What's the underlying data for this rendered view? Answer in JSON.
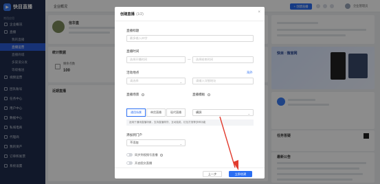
{
  "sidebar": {
    "brand": "快目直播",
    "section": "常用应用",
    "items": [
      {
        "label": "企业概况"
      },
      {
        "label": "直播"
      },
      {
        "label": "我的直播",
        "sub": true
      },
      {
        "label": "直播运营",
        "sub": true
      },
      {
        "label": "直播商城",
        "sub": true
      },
      {
        "label": "多渠道分发",
        "sub": true
      },
      {
        "label": "等级推送",
        "sub": true
      },
      {
        "label": "视频运营"
      },
      {
        "label": "团队账号"
      },
      {
        "label": "任务中心"
      },
      {
        "label": "用户中心"
      },
      {
        "label": "数据中心"
      },
      {
        "label": "私域电商"
      },
      {
        "label": "代理商"
      },
      {
        "label": "我的资产"
      },
      {
        "label": "订单和发票"
      },
      {
        "label": "系统设置"
      }
    ]
  },
  "topbar": {
    "title": "企业概况",
    "create_label": "+ 创建直播",
    "user_label": "企业管理员"
  },
  "background": {
    "company_name": "信华直",
    "stats_title": "统计数据",
    "recent_title": "近期直播",
    "online_label": "剩余点数",
    "online_value": "100",
    "promo_title": "快目 · 微官网",
    "tasks_title": "任务答疑",
    "notice_title": "最新公告"
  },
  "modal": {
    "title": "创建直播",
    "step": "(1/2)",
    "close": "×",
    "title_label": "直播标题",
    "title_placeholder": "最多输入20字",
    "time_label": "直播时间",
    "start_placeholder": "选择开播时间",
    "end_placeholder": "选择结束时间",
    "time_sep": "—",
    "location_label": "活动地点",
    "location_link": "海外",
    "location_placeholder": "请选择",
    "address_placeholder": "请输入详细地址",
    "scene_label": "直播场景",
    "template_label": "直播模板",
    "scene_options": [
      "通用场景",
      "带货直播",
      "现代直播"
    ],
    "template_value": "横屏",
    "scene_hint": "适用于通用直播场景，支持直播带货、互动抽奖、红包打赏等多种功能",
    "portal_label": "添加到门户",
    "portal_value": "不添加",
    "sync_label": "同步到视频号直播",
    "free_label": "开启图文直播",
    "prev_button": "上一步",
    "submit_button": "立即创建"
  },
  "colors": {
    "accent": "#2b6ef2",
    "sidebar_bg": "#1f2d4d",
    "arrow": "#e23b2e"
  }
}
